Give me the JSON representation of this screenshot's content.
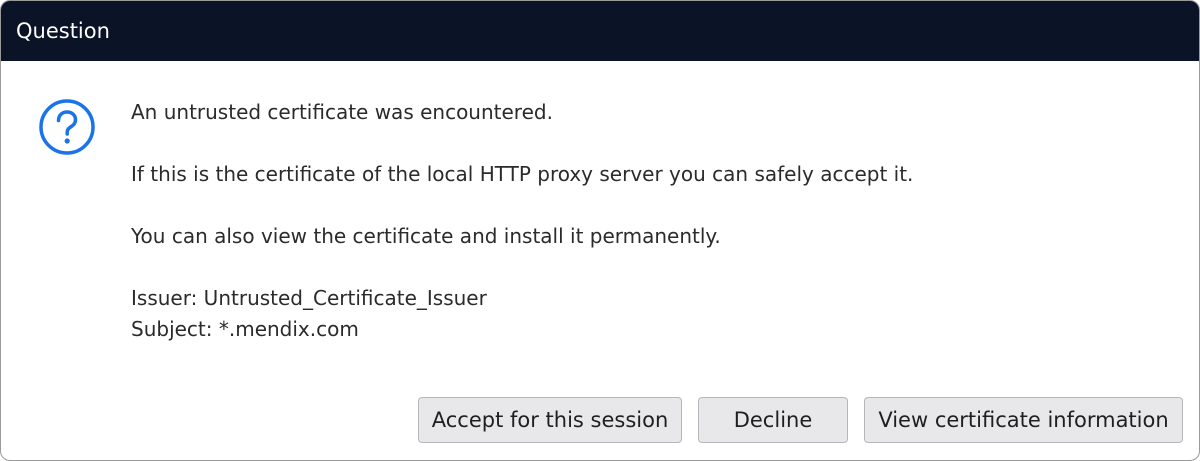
{
  "dialog": {
    "title": "Question",
    "icon": "question-circle-icon",
    "accent_color": "#1a73e8",
    "titlebar_color": "#0b1326",
    "message": {
      "line1": "An untrusted certificate was encountered.",
      "line2": "If this is the certificate of the local HTTP proxy server you can safely accept it.",
      "line3": "You can also view the certificate and install it permanently.",
      "issuer": "Issuer: Untrusted_Certificate_Issuer",
      "subject": "Subject: *.mendix.com"
    },
    "buttons": {
      "accept": "Accept for this session",
      "decline": "Decline",
      "view": "View certificate information"
    }
  }
}
